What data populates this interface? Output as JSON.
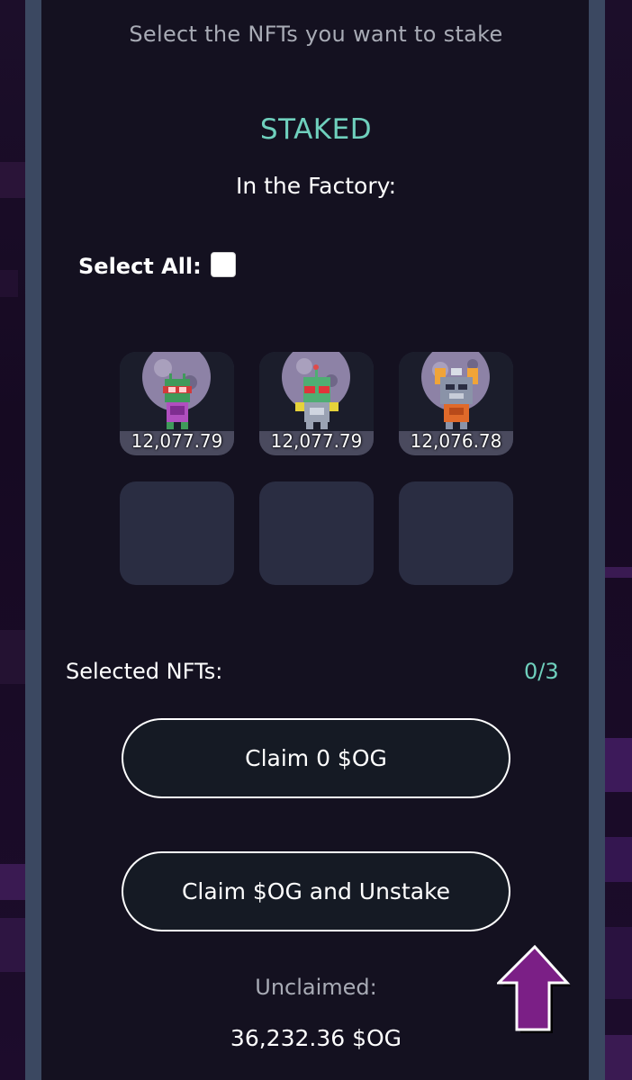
{
  "header": {
    "subtitle": "Select the NFTs you want to stake",
    "status": "STAKED",
    "location": "In the Factory:"
  },
  "selection": {
    "select_all_label": "Select All:",
    "select_all_checked": false,
    "selected_label": "Selected NFTs:",
    "selected_count": "0/3"
  },
  "nfts": [
    {
      "value": "12,077.79",
      "icon": "green-robot-red-goggles"
    },
    {
      "value": "12,077.79",
      "icon": "green-robot-heart-glasses"
    },
    {
      "value": "12,076.78",
      "icon": "orange-cat-robot"
    }
  ],
  "empty_slots": 3,
  "actions": {
    "claim_label": "Claim 0 $OG",
    "claim_unstake_label": "Claim $OG and Unstake"
  },
  "unclaimed": {
    "label": "Unclaimed:",
    "value": "36,232.36 $OG"
  },
  "colors": {
    "accent": "#6fd0bd",
    "panel": "#141120",
    "frame": "#3b4861",
    "card": "#2a2d42",
    "scroll_arrow": "#7b1f86"
  },
  "scroll_top_icon": "up-arrow-icon"
}
